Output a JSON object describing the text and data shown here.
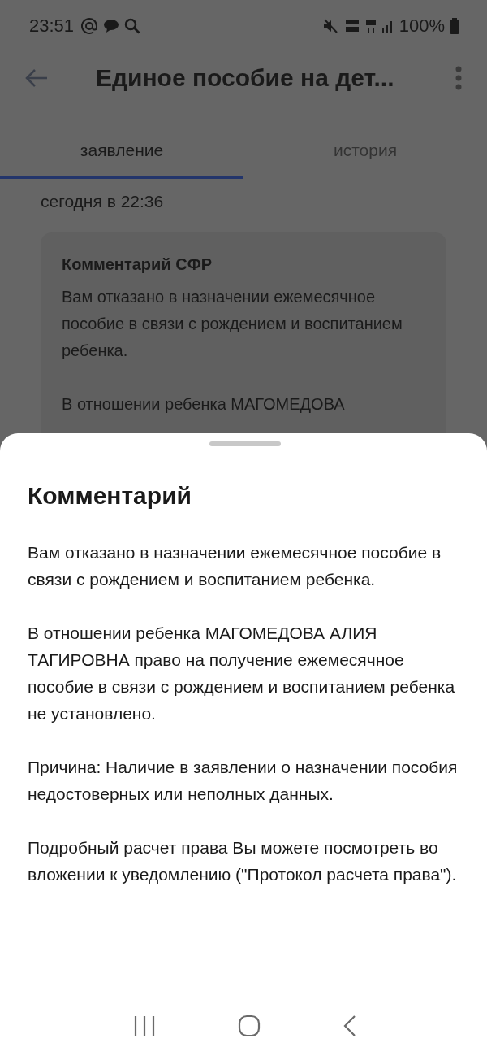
{
  "status_bar": {
    "time": "23:51",
    "battery": "100%"
  },
  "app_bar": {
    "title": "Единое пособие на дет..."
  },
  "tabs": [
    {
      "label": "заявление",
      "selected": true
    },
    {
      "label": "история",
      "selected": false
    }
  ],
  "background": {
    "timestamp": "сегодня в 22:36",
    "card": {
      "title": "Комментарий СФР",
      "paragraphs": [
        "Вам отказано в назначении ежемесячное пособие в связи с рождением и воспитанием ребенка.",
        "В отношении ребенка МАГОМЕДОВА"
      ]
    }
  },
  "sheet": {
    "title": "Комментарий",
    "paragraphs": [
      "Вам отказано в назначении ежемесячное пособие в связи с рождением и воспитанием ребенка.",
      "В отношении ребенка МАГОМЕДОВА АЛИЯ ТАГИРОВНА право на получение ежемесячное пособие в связи с рождением и воспитанием ребенка не установлено.",
      "Причина: Наличие в заявлении о назначении пособия недостоверных или неполных данных.",
      "Подробный расчет права Вы можете посмотреть во вложении к уведомлению (\"Протокол расчета права\")."
    ]
  }
}
